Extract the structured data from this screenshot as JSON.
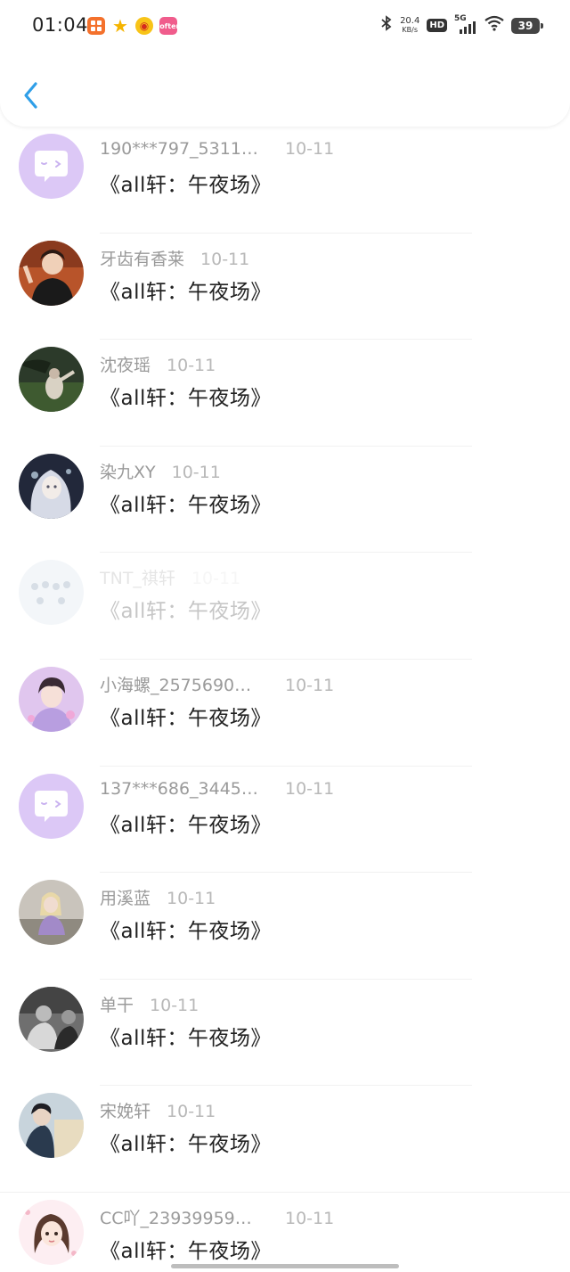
{
  "status_bar": {
    "time": "01:04",
    "net_speed_value": "20.4",
    "net_speed_unit": "KB/s",
    "hd_label": "HD",
    "network_label": "5G",
    "battery_level": "39",
    "app_icons": [
      "taobao-style-icon",
      "star-icon",
      "weibo-icon",
      "lofter-icon"
    ],
    "pink_icon_label": "lofter"
  },
  "header": {
    "back_icon": "chevron-left-icon",
    "accent_color": "#2f9fe8"
  },
  "list": {
    "items": [
      {
        "name": "190***797_53111…",
        "date": "10-11",
        "message": "《all轩：午夜场》",
        "avatar": "default-chat-avatar",
        "truncated": true
      },
      {
        "name": "牙齿有香莱",
        "date": "10-11",
        "message": "《all轩：午夜场》",
        "avatar": "photo-avatar",
        "truncated": false
      },
      {
        "name": "沈夜瑶",
        "date": "10-11",
        "message": "《all轩：午夜场》",
        "avatar": "photo-avatar",
        "truncated": false
      },
      {
        "name": "染九XY",
        "date": "10-11",
        "message": "《all轩：午夜场》",
        "avatar": "photo-avatar",
        "truncated": false
      },
      {
        "name": "TNT_祺轩",
        "date": "10-11",
        "message": "《all轩：午夜场》",
        "avatar": "photo-avatar",
        "truncated": false
      },
      {
        "name": "小海螺_2575690…",
        "date": "10-11",
        "message": "《all轩：午夜场》",
        "avatar": "photo-avatar",
        "truncated": true
      },
      {
        "name": "137***686_3445…",
        "date": "10-11",
        "message": "《all轩：午夜场》",
        "avatar": "default-chat-avatar",
        "truncated": true
      },
      {
        "name": "用溪蓝",
        "date": "10-11",
        "message": "《all轩：午夜场》",
        "avatar": "photo-avatar",
        "truncated": false
      },
      {
        "name": "单干",
        "date": "10-11",
        "message": "《all轩：午夜场》",
        "avatar": "photo-avatar",
        "truncated": false
      },
      {
        "name": "宋娩轩",
        "date": "10-11",
        "message": "《all轩：午夜场》",
        "avatar": "photo-avatar",
        "truncated": false
      },
      {
        "name": "CC吖_23939959…",
        "date": "10-11",
        "message": "《all轩：午夜场》",
        "avatar": "photo-avatar",
        "truncated": true
      }
    ]
  },
  "colors": {
    "default_avatar_bg": "#dcc8f6",
    "name_text": "#9a9a9a",
    "date_text": "#b8b8b8",
    "message_text": "#222222"
  }
}
